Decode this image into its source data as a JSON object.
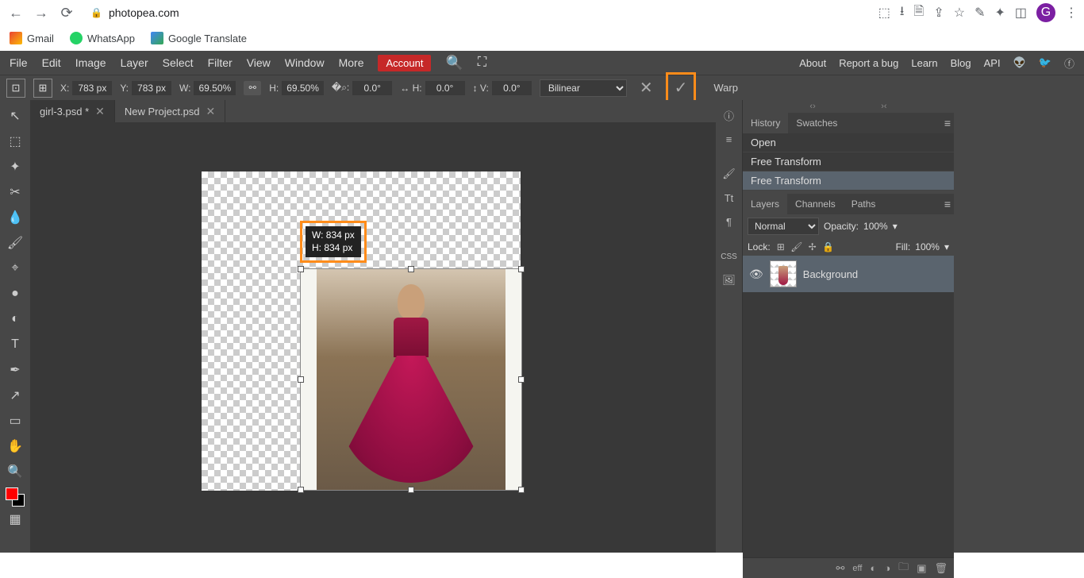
{
  "browser": {
    "url": "photopea.com",
    "bookmarks": [
      {
        "label": "Gmail"
      },
      {
        "label": "WhatsApp"
      },
      {
        "label": "Google Translate"
      }
    ],
    "avatar": "G"
  },
  "menu": {
    "items": [
      "File",
      "Edit",
      "Image",
      "Layer",
      "Select",
      "Filter",
      "View",
      "Window",
      "More"
    ],
    "account": "Account",
    "right": [
      "About",
      "Report a bug",
      "Learn",
      "Blog",
      "API"
    ]
  },
  "optbar": {
    "x_label": "X:",
    "x_val": "783 px",
    "y_label": "Y:",
    "y_val": "783 px",
    "w_label": "W:",
    "w_val": "69.50%",
    "h_label": "H:",
    "h_val": "69.50%",
    "a_label": "�⌕:",
    "a_val": "0.0°",
    "sh_label": "↔ H:",
    "sh_val": "0.0°",
    "sv_label": "↕ V:",
    "sv_val": "0.0°",
    "interp": "Bilinear",
    "warp": "Warp"
  },
  "tabs": [
    {
      "label": "girl-3.psd *",
      "active": true
    },
    {
      "label": "New Project.psd",
      "active": false
    }
  ],
  "tooltip": {
    "w": "W: 834 px",
    "h": "H: 834 px"
  },
  "panels": {
    "history_tab": "History",
    "swatches_tab": "Swatches",
    "history_items": [
      "Open",
      "Free Transform",
      "Free Transform"
    ],
    "layers_tab": "Layers",
    "channels_tab": "Channels",
    "paths_tab": "Paths",
    "blend_mode": "Normal",
    "opacity_label": "Opacity:",
    "opacity_val": "100%",
    "lock_label": "Lock:",
    "fill_label": "Fill:",
    "fill_val": "100%",
    "layer_name": "Background"
  }
}
